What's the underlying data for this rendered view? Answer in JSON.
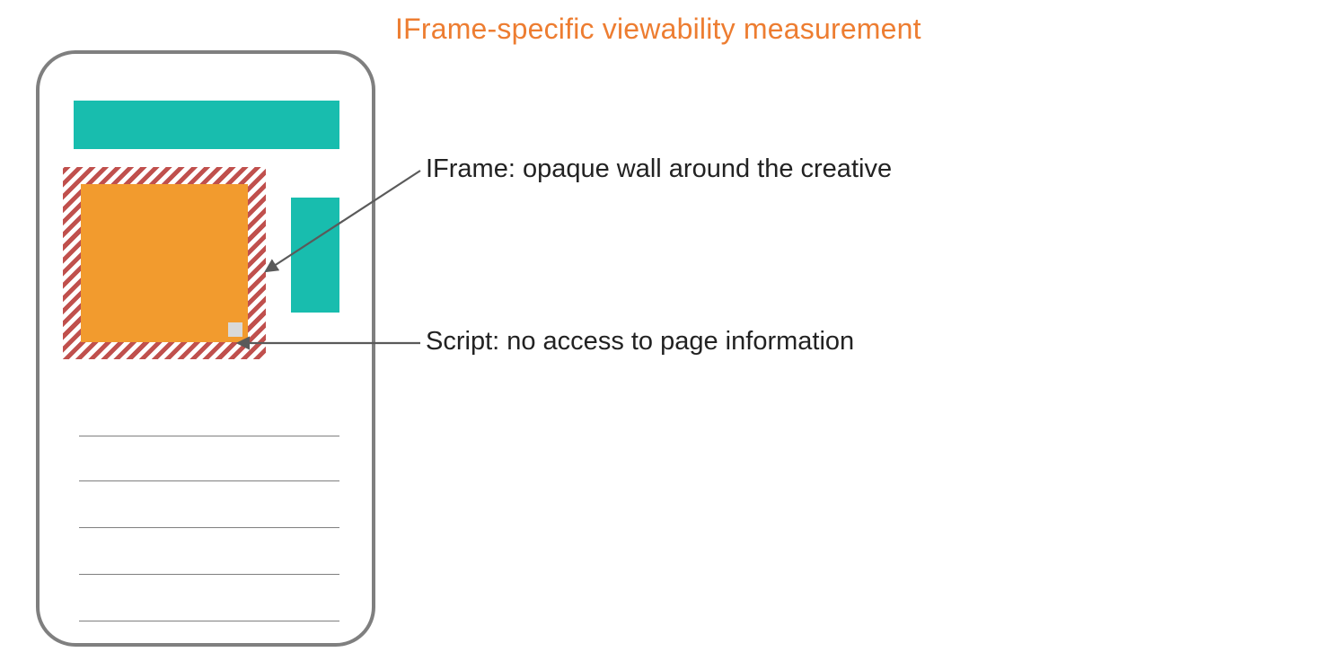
{
  "title": "IFrame-specific viewability measurement",
  "labels": {
    "iframe": "IFrame: opaque wall around the creative",
    "script": "Script: no access to page information"
  },
  "colors": {
    "accent_orange": "#ED7D31",
    "teal": "#18BDAE",
    "ad_orange": "#F29B2E",
    "stripe_red": "#C0504D",
    "phone_border": "#7f7f7f",
    "script_dot": "#d9d9d9"
  },
  "diagram": {
    "type": "annotated-illustration",
    "device": "phone-wireframe",
    "elements": [
      {
        "name": "header-block",
        "shape": "rect",
        "color": "teal"
      },
      {
        "name": "iframe-hatched-border",
        "shape": "hatched-rect",
        "color": "stripe_red"
      },
      {
        "name": "creative-box",
        "shape": "rect",
        "color": "ad_orange"
      },
      {
        "name": "script-dot",
        "shape": "small-square",
        "color": "script_dot"
      },
      {
        "name": "side-block",
        "shape": "rect",
        "color": "teal"
      },
      {
        "name": "content-lines",
        "count": 5
      }
    ],
    "callouts": [
      {
        "target": "iframe-hatched-border",
        "label_key": "iframe"
      },
      {
        "target": "script-dot",
        "label_key": "script"
      }
    ]
  }
}
